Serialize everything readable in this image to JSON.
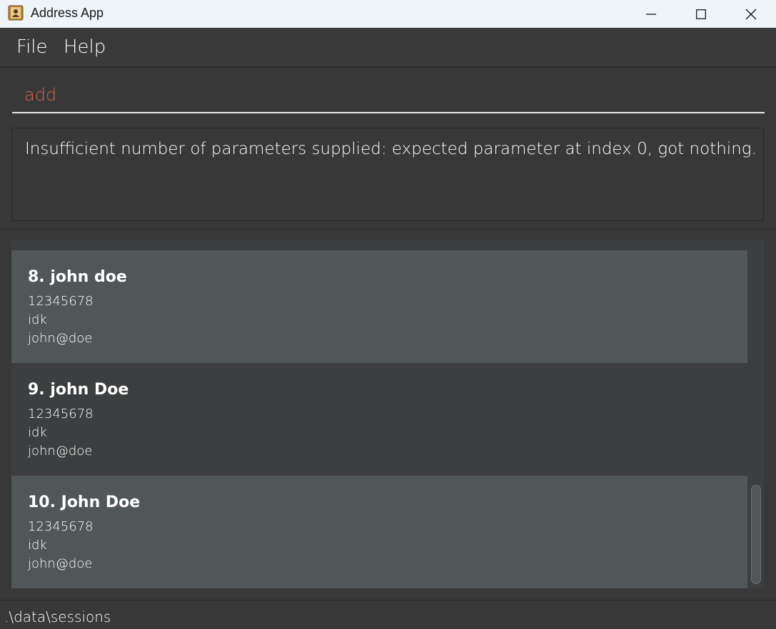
{
  "window": {
    "title": "Address App",
    "icon": "address-book-icon",
    "controls": [
      "minimize-icon",
      "maximize-icon",
      "close-icon"
    ]
  },
  "menu": {
    "items": [
      {
        "label": "File"
      },
      {
        "label": "Help"
      }
    ]
  },
  "command": {
    "value": "add",
    "text_color": "#d06651"
  },
  "result": {
    "message": "Insufficient number of parameters supplied: expected parameter at index 0, got nothing."
  },
  "persons": [
    {
      "name": "8. john doe",
      "phone": "12345678",
      "address": "idk",
      "email": "john@doe"
    },
    {
      "name": "9. john Doe",
      "phone": "12345678",
      "address": "idk",
      "email": "john@doe"
    },
    {
      "name": "10. John Doe",
      "phone": "12345678",
      "address": "idk",
      "email": "john@doe"
    }
  ],
  "status": {
    "path": ".\\data\\sessions"
  },
  "colors": {
    "background": "#383838",
    "card_highlight": "#515658",
    "card_normal": "#3c3e3f",
    "titlebar": "#eff4f9"
  }
}
